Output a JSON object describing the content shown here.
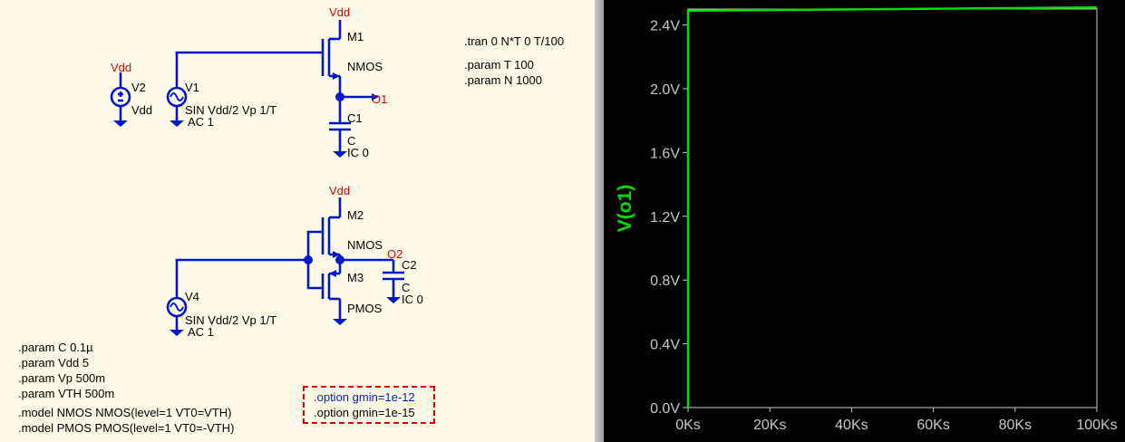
{
  "schematic": {
    "components": {
      "m1": {
        "name": "M1",
        "model": "NMOS"
      },
      "m2": {
        "name": "M2",
        "model": "NMOS"
      },
      "m3": {
        "name": "M3",
        "model": "PMOS"
      },
      "v1": {
        "name": "V1",
        "value": "SIN Vdd/2 Vp 1/T",
        "ac": "AC 1"
      },
      "v2": {
        "name": "V2",
        "value": "Vdd"
      },
      "v4": {
        "name": "V4",
        "value": "SIN Vdd/2 Vp 1/T",
        "ac": "AC 1"
      },
      "c1": {
        "name": "C1",
        "value": "C",
        "ic": "IC 0"
      },
      "c2": {
        "name": "C2",
        "value": "C",
        "ic": "IC 0"
      }
    },
    "net_labels": {
      "vdd": "Vdd",
      "o1": "O1",
      "o2": "O2"
    },
    "directives_top": [
      ".tran 0 N*T 0 T/100",
      ".param T 100",
      ".param N 1000"
    ],
    "directives_bottom": [
      ".param C 0.1µ",
      ".param Vdd 5",
      ".param Vp 500m",
      ".param VTH 500m",
      ".model NMOS NMOS(level=1 VT0=VTH)",
      ".model PMOS PMOS(level=1 VT0=-VTH)"
    ],
    "options": [
      ".option gmin=1e-12",
      ".option gmin=1e-15"
    ],
    "colors": {
      "wire": "#0018cc",
      "net_label": "#e00000",
      "option_active": "#0018cc",
      "option_box": "#e00000"
    }
  },
  "plot": {
    "trace_label": "V(o1)",
    "y_ticks": [
      "2.4V",
      "2.0V",
      "1.6V",
      "1.2V",
      "0.8V",
      "0.4V",
      "0.0V"
    ],
    "x_ticks": [
      "0Ks",
      "20Ks",
      "40Ks",
      "60Ks",
      "80Ks",
      "100Ks"
    ],
    "trace_color": "#00e000"
  },
  "chart_data": {
    "type": "line",
    "title": "",
    "xlabel": "",
    "ylabel": "V(o1)",
    "xlim": [
      0,
      100
    ],
    "x_unit": "Ks",
    "ylim": [
      0,
      2.5
    ],
    "series": [
      {
        "name": "V(o1)",
        "x": [
          0,
          0,
          0.5,
          100
        ],
        "y": [
          0,
          2.49,
          2.49,
          2.51
        ]
      }
    ],
    "grid": false
  }
}
